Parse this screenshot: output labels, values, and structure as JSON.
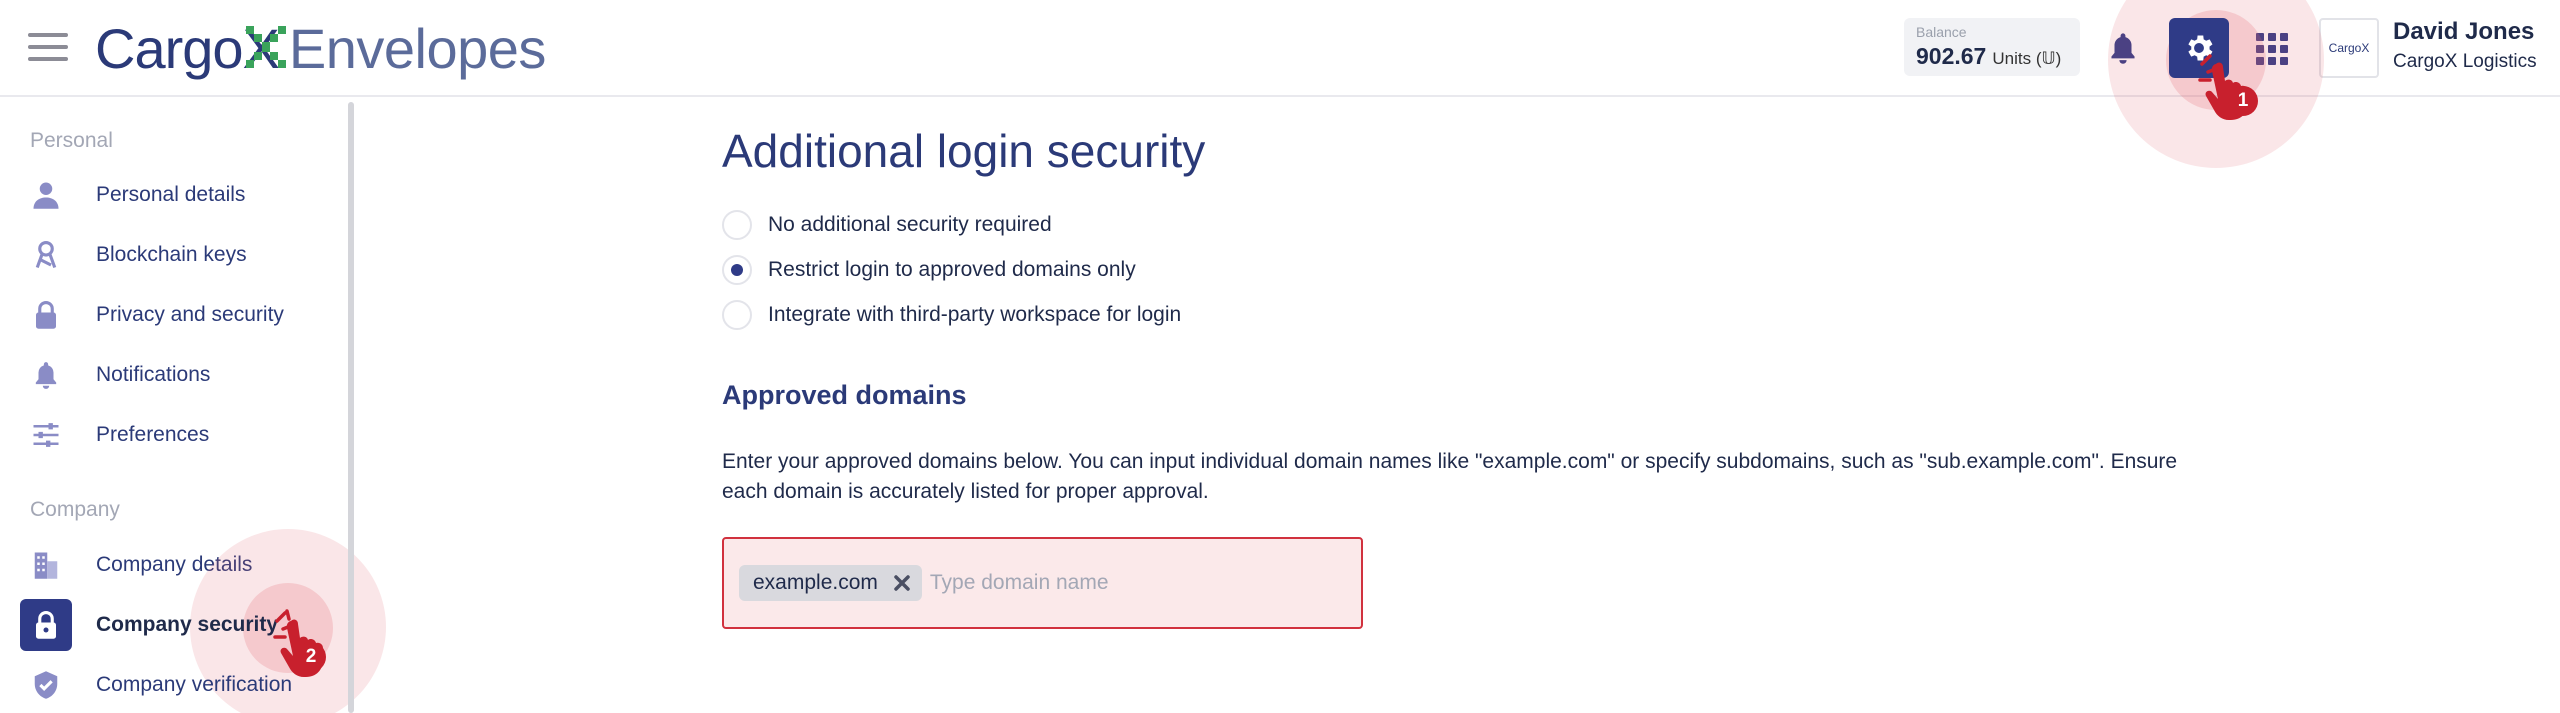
{
  "header": {
    "logo_text": "CargoX",
    "product": "Envelopes",
    "balance": {
      "label": "Balance",
      "value": "902.67",
      "unit": "Units (𝕌)"
    },
    "user": {
      "name": "David Jones",
      "company": "CargoX Logistics",
      "avatar_text": "CargoX"
    },
    "icons": [
      "menu-icon",
      "bell-icon",
      "gear-icon",
      "apps-grid-icon"
    ]
  },
  "sidebar": {
    "personal_title": "Personal",
    "company_title": "Company",
    "personal_items": [
      {
        "label": "Personal details",
        "icon": "person-icon"
      },
      {
        "label": "Blockchain keys",
        "icon": "key-icon"
      },
      {
        "label": "Privacy and security",
        "icon": "lock-icon"
      },
      {
        "label": "Notifications",
        "icon": "bell-icon"
      },
      {
        "label": "Preferences",
        "icon": "sliders-icon"
      }
    ],
    "company_items": [
      {
        "label": "Company details",
        "icon": "building-icon"
      },
      {
        "label": "Company security",
        "icon": "lock-icon",
        "active": true
      },
      {
        "label": "Company verification",
        "icon": "shield-check-icon"
      }
    ]
  },
  "main": {
    "title": "Additional login security",
    "options": [
      {
        "label": "No additional security required",
        "checked": false
      },
      {
        "label": "Restrict login to approved domains only",
        "checked": true
      },
      {
        "label": "Integrate with third-party workspace for login",
        "checked": false
      }
    ],
    "approved_title": "Approved domains",
    "description": "Enter your approved domains below. You can input individual domain names like \"example.com\" or specify subdomains, such as \"sub.example.com\". Ensure each domain is accurately listed for proper approval.",
    "domains": [
      "example.com"
    ],
    "input_placeholder": "Type domain name"
  },
  "steps": [
    "1",
    "2"
  ],
  "colors": {
    "primary": "#2f3b87",
    "accent_red": "#c8202d",
    "logo_green": "#3aa35b"
  }
}
